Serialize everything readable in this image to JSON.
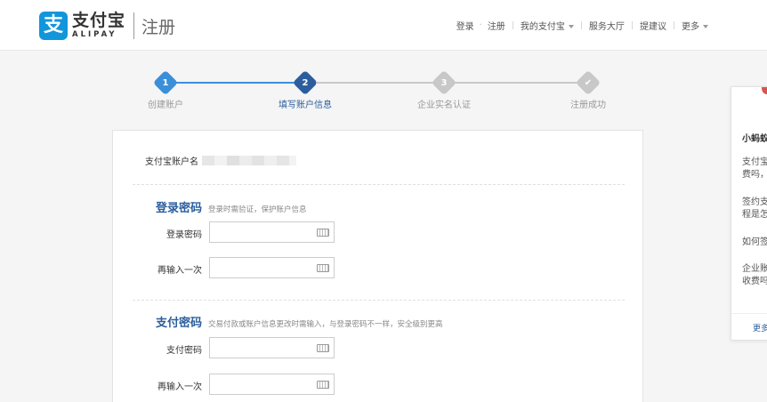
{
  "header": {
    "logo_char": "支",
    "logo_cn": "支付宝",
    "logo_en": "ALIPAY",
    "page_title": "注册",
    "nav": {
      "login": "登录",
      "register": "注册",
      "my_alipay": "我的支付宝",
      "service_hall": "服务大厅",
      "suggest": "提建议",
      "more": "更多"
    }
  },
  "steps": [
    {
      "num": "1",
      "label": "创建账户",
      "state": "done"
    },
    {
      "num": "2",
      "label": "填写账户信息",
      "state": "active"
    },
    {
      "num": "3",
      "label": "企业实名认证",
      "state": "todo"
    },
    {
      "num": "✔",
      "label": "注册成功",
      "state": "todo"
    }
  ],
  "form": {
    "account_label": "支付宝账户名",
    "login_pw": {
      "title": "登录密码",
      "hint": "登录时需验证，保护账户信息",
      "field1_label": "登录密码",
      "field2_label": "再输入一次"
    },
    "pay_pw": {
      "title": "支付密码",
      "hint": "交易付款或账户信息更改时需输入，与登录密码不一样，安全级别更高",
      "field1_label": "支付密码",
      "field2_label": "再输入一次"
    }
  },
  "side_panel": {
    "title": "小蚂蚁",
    "q1_line1": "支付宝",
    "q1_line2": "费吗，",
    "q2_line1": "签约支",
    "q2_line2": "程是怎",
    "q3": "如何签",
    "q4_line1": "企业账",
    "q4_line2": "收费吗",
    "more": "更多"
  },
  "colors": {
    "accent": "#2c5e9e",
    "step_done": "#3b8fd9",
    "step_active": "#2c5e9e",
    "step_todo": "#c8c8c8",
    "brand": "#1296db"
  }
}
